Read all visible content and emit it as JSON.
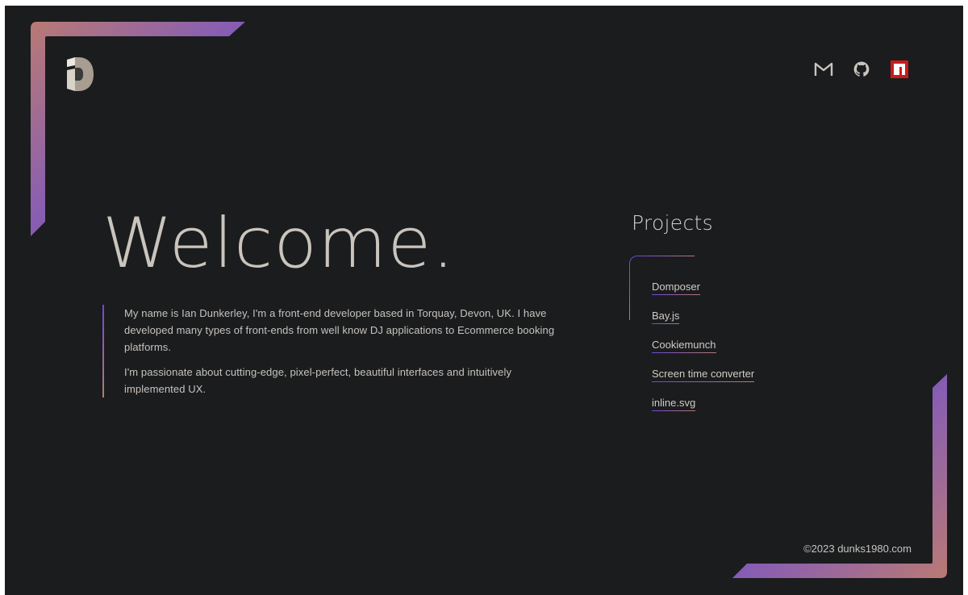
{
  "header": {
    "logo_icon": "d-monogram-logo",
    "social_links": [
      {
        "name": "gmail",
        "icon": "gmail-icon"
      },
      {
        "name": "github",
        "icon": "github-icon"
      },
      {
        "name": "npm",
        "icon": "npm-icon"
      }
    ]
  },
  "hero": {
    "title": "Welcome.",
    "paragraphs": [
      "My name is Ian Dunkerley, I'm a front-end developer based in Torquay, Devon, UK. I have developed many types of front-ends from well know DJ applications to Ecommerce booking platforms.",
      "I'm passionate about cutting-edge, pixel-perfect, beautiful interfaces and intuitively implemented UX."
    ]
  },
  "projects": {
    "title": "Projects",
    "items": [
      {
        "label": "Domposer"
      },
      {
        "label": "Bay.js"
      },
      {
        "label": "Cookiemunch"
      },
      {
        "label": "Screen time converter"
      },
      {
        "label": "inline.svg"
      }
    ]
  },
  "footer": {
    "copyright": "©2023 dunks1980.com"
  },
  "colors": {
    "background": "#1b1c1e",
    "accent_purple": "#6a49d6",
    "accent_rose": "#b97a74",
    "text": "#c9c4bd",
    "npm_red": "#cb1a1a"
  }
}
